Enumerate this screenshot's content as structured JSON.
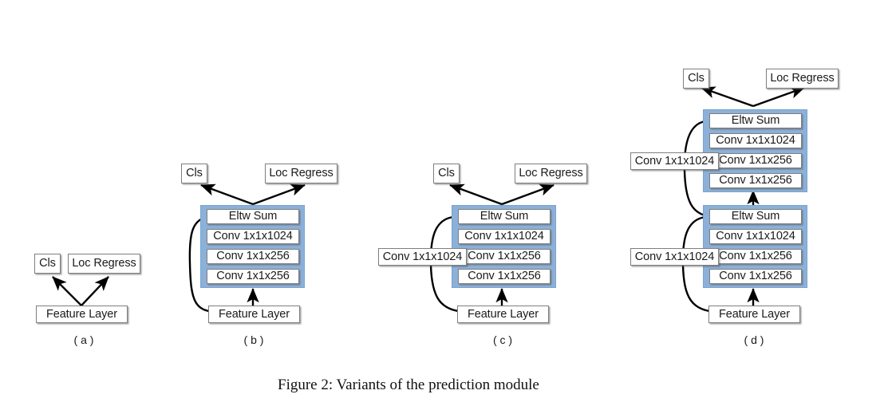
{
  "figure": {
    "caption": "Figure 2: Variants of the prediction module",
    "background_color": "#ffffff",
    "module_color": "#8cb1d9",
    "node_color": "#ffffff",
    "stroke_color": "#000000"
  },
  "labels": {
    "cls": "Cls",
    "loc_regress": "Loc Regress",
    "feature_layer": "Feature Layer",
    "eltw_sum": "Eltw Sum",
    "conv_1024": "Conv 1x1x1024",
    "conv_256": "Conv 1x1x256"
  },
  "panels": [
    {
      "id": "a",
      "label": "( a )",
      "nodes": [
        {
          "name": "cls-box",
          "text": "Cls"
        },
        {
          "name": "loc-regress-box",
          "text": "Loc Regress"
        },
        {
          "name": "feature-layer-box",
          "text": "Feature Layer"
        }
      ]
    },
    {
      "id": "b",
      "label": "( b )",
      "nodes": [
        {
          "name": "cls-box",
          "text": "Cls"
        },
        {
          "name": "loc-regress-box",
          "text": "Loc Regress"
        },
        {
          "name": "eltw-sum-box",
          "text": "Eltw Sum"
        },
        {
          "name": "conv-1024-box",
          "text": "Conv 1x1x1024"
        },
        {
          "name": "conv-256-box-1",
          "text": "Conv 1x1x256"
        },
        {
          "name": "conv-256-box-2",
          "text": "Conv 1x1x256"
        },
        {
          "name": "feature-layer-box",
          "text": "Feature Layer"
        }
      ]
    },
    {
      "id": "c",
      "label": "( c )",
      "nodes": [
        {
          "name": "cls-box",
          "text": "Cls"
        },
        {
          "name": "loc-regress-box",
          "text": "Loc Regress"
        },
        {
          "name": "eltw-sum-box",
          "text": "Eltw Sum"
        },
        {
          "name": "conv-1024-box",
          "text": "Conv 1x1x1024"
        },
        {
          "name": "conv-256-box-1",
          "text": "Conv 1x1x256"
        },
        {
          "name": "conv-256-box-2",
          "text": "Conv 1x1x256"
        },
        {
          "name": "skip-conv-1024-box",
          "text": "Conv 1x1x1024"
        },
        {
          "name": "feature-layer-box",
          "text": "Feature Layer"
        }
      ]
    },
    {
      "id": "d",
      "label": "( d )",
      "nodes": [
        {
          "name": "cls-box",
          "text": "Cls"
        },
        {
          "name": "loc-regress-box",
          "text": "Loc Regress"
        },
        {
          "name": "upper-eltw-sum-box",
          "text": "Eltw Sum"
        },
        {
          "name": "upper-conv-1024-box",
          "text": "Conv 1x1x1024"
        },
        {
          "name": "upper-conv-256-box-1",
          "text": "Conv 1x1x256"
        },
        {
          "name": "upper-conv-256-box-2",
          "text": "Conv 1x1x256"
        },
        {
          "name": "upper-skip-conv-1024-box",
          "text": "Conv 1x1x1024"
        },
        {
          "name": "lower-eltw-sum-box",
          "text": "Eltw Sum"
        },
        {
          "name": "lower-conv-1024-box",
          "text": "Conv 1x1x1024"
        },
        {
          "name": "lower-conv-256-box-1",
          "text": "Conv 1x1x256"
        },
        {
          "name": "lower-conv-256-box-2",
          "text": "Conv 1x1x256"
        },
        {
          "name": "lower-skip-conv-1024-box",
          "text": "Conv 1x1x1024"
        },
        {
          "name": "feature-layer-box",
          "text": "Feature Layer"
        }
      ]
    }
  ]
}
